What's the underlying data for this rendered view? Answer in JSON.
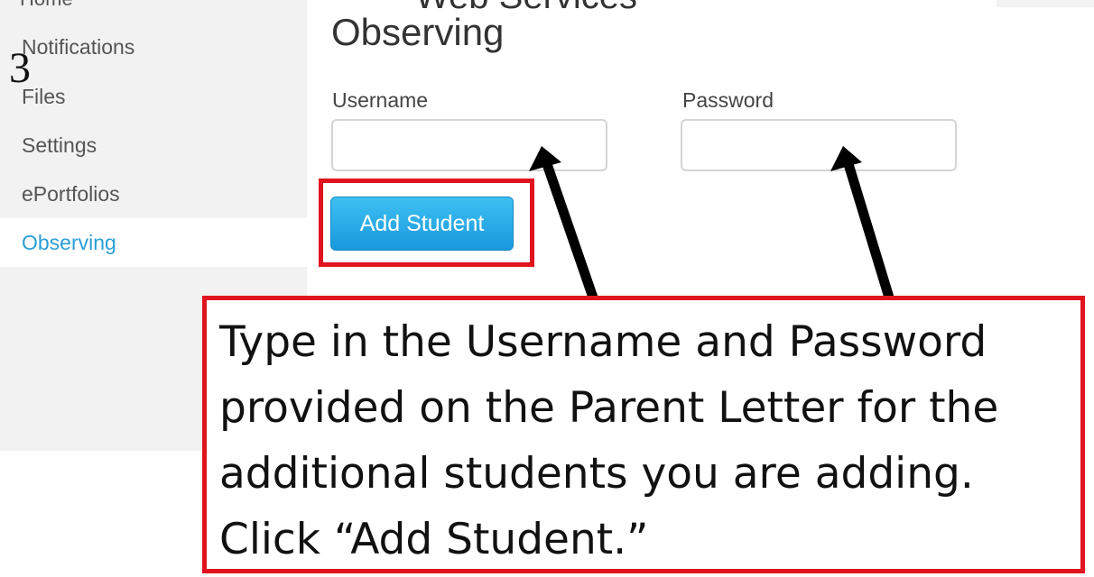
{
  "step_number": "3",
  "sidebar": {
    "clipped_item": "Home",
    "items": [
      {
        "label": "Notifications",
        "active": false
      },
      {
        "label": "Files",
        "active": false
      },
      {
        "label": "Settings",
        "active": false
      },
      {
        "label": "ePortfolios",
        "active": false
      },
      {
        "label": "Observing",
        "active": true
      }
    ]
  },
  "panel": {
    "clipped_header": "Web Services",
    "title": "Observing",
    "username_label": "Username",
    "username_value": "",
    "password_label": "Password",
    "password_value": "",
    "add_button_label": "Add Student"
  },
  "callout": {
    "text": "Type in the Username and Password\nprovided on the Parent Letter for the\nadditional students you are adding.\nClick “Add Student.”"
  },
  "colors": {
    "accent": "#2a9fd6",
    "highlight": "#e0141e",
    "button": "#1a98dd",
    "sidebar_bg": "#f2f2f2"
  }
}
